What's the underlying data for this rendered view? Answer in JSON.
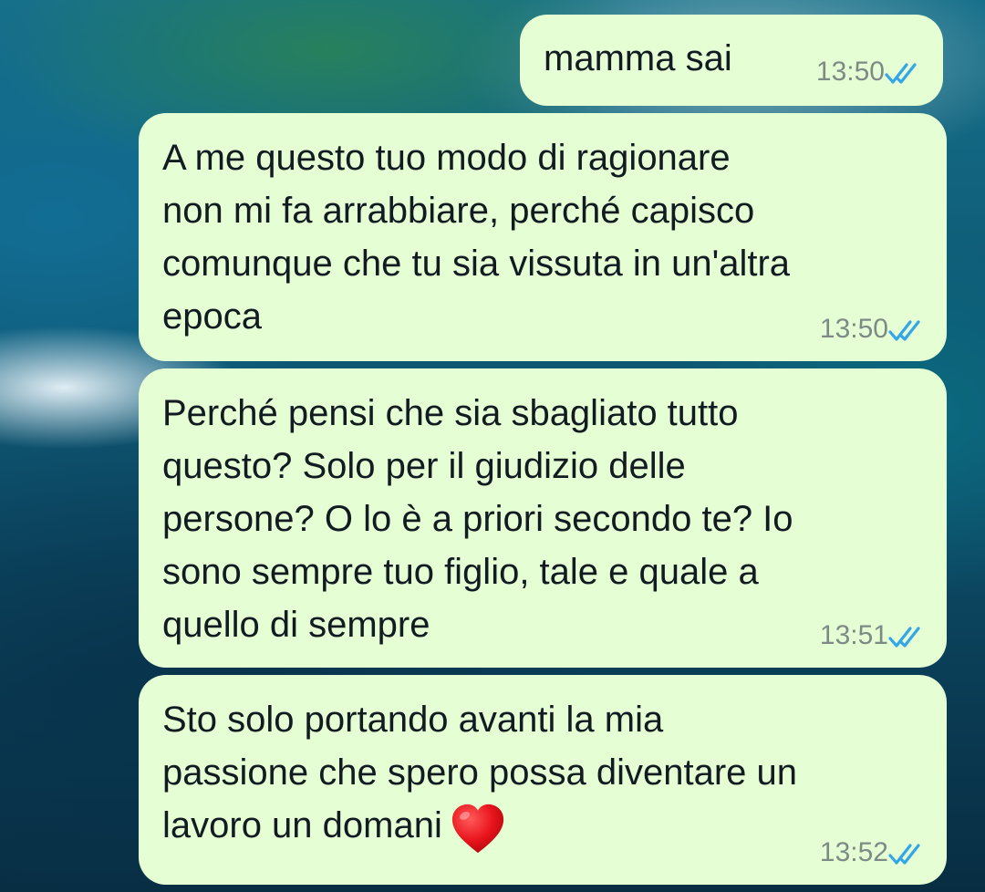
{
  "colors": {
    "bubble_background": "#e6fed4",
    "text": "#111b21",
    "time": "#7d8a86",
    "read_ticks": "#34a6e8"
  },
  "messages": [
    {
      "text": "mamma sai",
      "time": "13:50",
      "status_icon": "double-check-read-icon"
    },
    {
      "text": "A me questo tuo modo di ragionare\nnon mi fa arrabbiare, perché capisco\ncomunque che tu sia vissuta in un'altra\nepoca",
      "time": "13:50",
      "status_icon": "double-check-read-icon"
    },
    {
      "text": "Perché pensi che sia sbagliato tutto\nquesto? Solo per il giudizio delle\npersone? O lo è a priori secondo te? Io\nsono sempre tuo figlio, tale e quale a\nquello di sempre",
      "time": "13:51",
      "status_icon": "double-check-read-icon"
    },
    {
      "text": "Sto solo portando avanti la mia\npassione che spero possa diventare un\nlavoro un domani",
      "emoji": "red-heart-icon",
      "time": "13:52",
      "status_icon": "double-check-read-icon"
    }
  ]
}
